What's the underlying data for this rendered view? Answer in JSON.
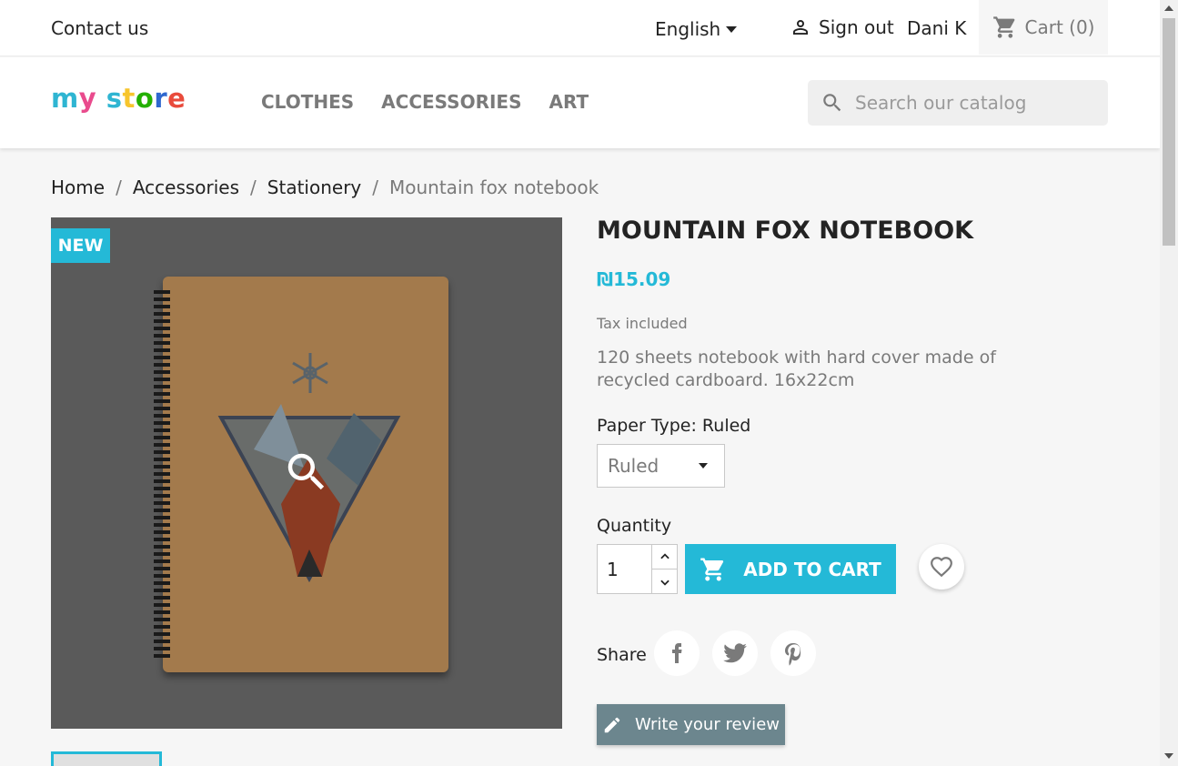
{
  "topbar": {
    "contact": "Contact us",
    "language": "English",
    "signout": "Sign out",
    "username": "Dani K",
    "cart": "Cart (0)"
  },
  "header": {
    "logo_parts": [
      "m",
      "y",
      " ",
      "s",
      "t",
      "o",
      "r",
      "e"
    ],
    "logo_colors": [
      "#2fb5d2",
      "#e94b8d",
      "#ffffff",
      "#2fb5d2",
      "#f7c52d",
      "#24b000",
      "#2f68cf",
      "#e94b3c"
    ],
    "nav": [
      "CLOTHES",
      "ACCESSORIES",
      "ART"
    ],
    "search_placeholder": "Search our catalog"
  },
  "breadcrumb": {
    "items": [
      "Home",
      "Accessories",
      "Stationery"
    ],
    "current": "Mountain fox notebook",
    "separator": "/"
  },
  "product": {
    "badge": "NEW",
    "title": "MOUNTAIN FOX NOTEBOOK",
    "price": "₪15.09",
    "tax": "Tax included",
    "description": "120 sheets notebook with hard cover made of recycled cardboard. 16x22cm",
    "variant_label": "Paper Type: Ruled",
    "variant_value": "Ruled",
    "quantity_label": "Quantity",
    "quantity_value": "1",
    "add_to_cart": "ADD TO CART",
    "share_label": "Share",
    "write_review": "Write your review"
  },
  "colors": {
    "accent": "#24b9d7",
    "review_button": "#6c868e"
  }
}
